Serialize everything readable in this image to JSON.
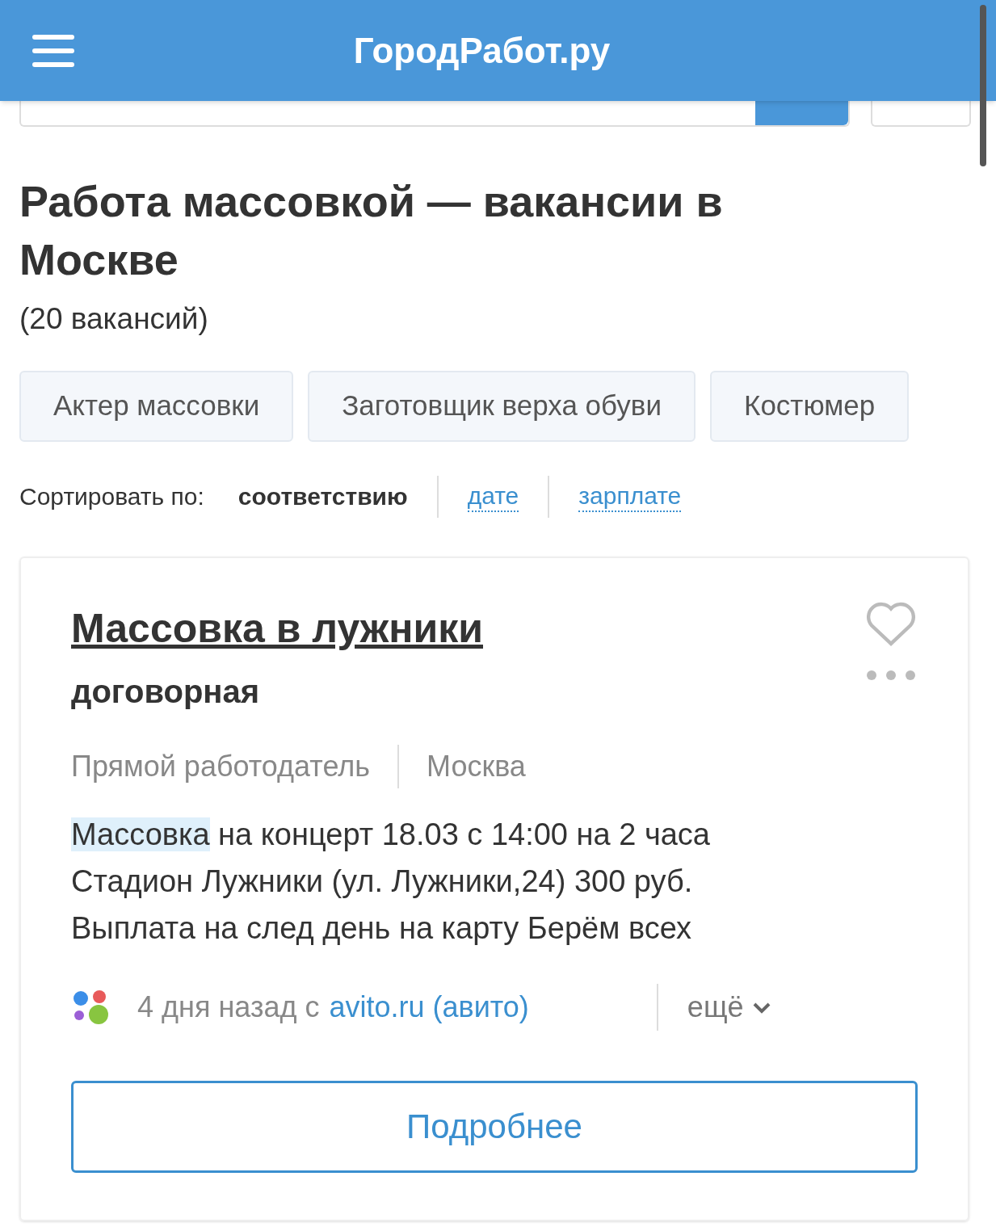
{
  "header": {
    "logo": "ГородРабот.ру"
  },
  "page_title": "Работа массовкой — вакансии в Москве",
  "count": "(20 вакансий)",
  "tags": [
    {
      "label": "Актер массовки"
    },
    {
      "label": "Заготовщик верха обуви"
    },
    {
      "label": "Костюмер"
    }
  ],
  "sort": {
    "label": "Сортировать по:",
    "options": [
      {
        "label": "соответствию",
        "selected": true
      },
      {
        "label": "дате",
        "selected": false
      },
      {
        "label": "зарплате",
        "selected": false
      }
    ]
  },
  "vacancy": {
    "title": "Массовка в лужники",
    "salary": "договорная",
    "favorite": false,
    "employer": "Прямой работодатель",
    "city": "Москва",
    "description": [
      {
        "text": "Массовка",
        "highlighted": true
      },
      {
        "text": " на концерт 18.03 с 14:00 на 2 часа Стадион Лужники (ул. Лужники,24) 300 руб. Выплата на след день на карту Берём всех",
        "highlighted": false
      }
    ],
    "posted": "4 дня назад с",
    "source": "avito.ru (авито)",
    "more": "ещё",
    "details_button": "Подробнее"
  }
}
